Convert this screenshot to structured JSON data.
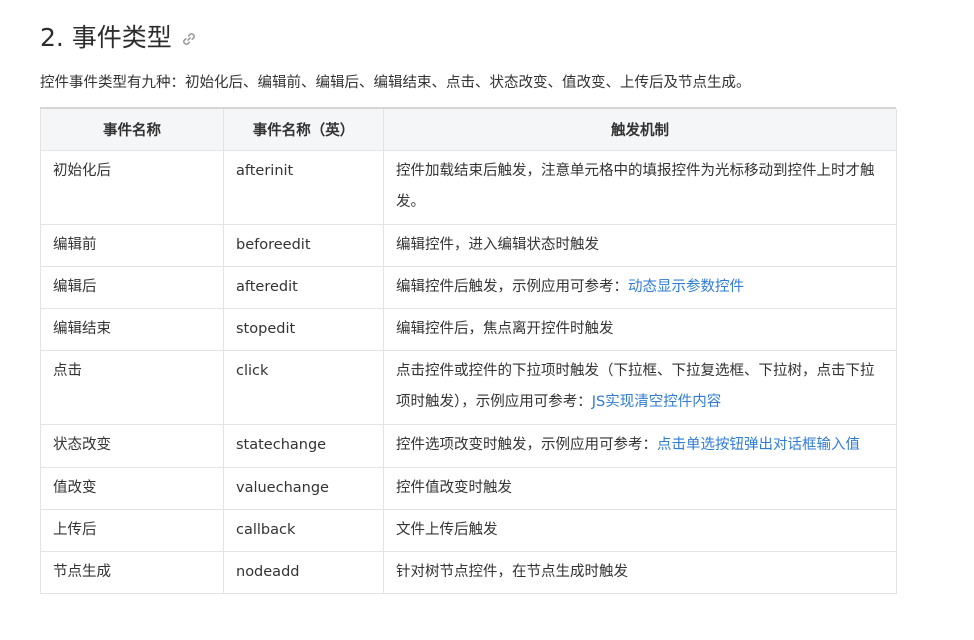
{
  "heading": {
    "title": "2. 事件类型",
    "link_icon": "link-icon"
  },
  "intro": "控件事件类型有九种：初始化后、编辑前、编辑后、编辑结束、点击、状态改变、值改变、上传后及节点生成。",
  "colors": {
    "link": "#2f7cd6",
    "header_bg": "#f5f6f8",
    "border": "#e3e3e3"
  },
  "table": {
    "headers": [
      "事件名称",
      "事件名称（英）",
      "触发机制"
    ],
    "rows": [
      {
        "name": "初始化后",
        "en": "afterinit",
        "desc": "控件加载结束后触发，注意单元格中的填报控件为光标移动到控件上时才触发。",
        "link": ""
      },
      {
        "name": "编辑前",
        "en": "beforeedit",
        "desc": "编辑控件，进入编辑状态时触发",
        "link": ""
      },
      {
        "name": "编辑后",
        "en": "afteredit",
        "desc": "编辑控件后触发，示例应用可参考：",
        "link": "动态显示参数控件"
      },
      {
        "name": "编辑结束",
        "en": "stopedit",
        "desc": "编辑控件后，焦点离开控件时触发",
        "link": ""
      },
      {
        "name": "点击",
        "en": "click",
        "desc": "点击控件或控件的下拉项时触发（下拉框、下拉复选框、下拉树，点击下拉项时触发），示例应用可参考：",
        "link": "JS实现清空控件内容"
      },
      {
        "name": "状态改变",
        "en": "statechange",
        "desc": "控件选项改变时触发，示例应用可参考：",
        "link": "点击单选按钮弹出对话框输入值"
      },
      {
        "name": "值改变",
        "en": "valuechange",
        "desc": "控件值改变时触发",
        "link": ""
      },
      {
        "name": "上传后",
        "en": "callback",
        "desc": "文件上传后触发",
        "link": ""
      },
      {
        "name": "节点生成",
        "en": "nodeadd",
        "desc": "针对树节点控件，在节点生成时触发",
        "link": ""
      }
    ]
  }
}
